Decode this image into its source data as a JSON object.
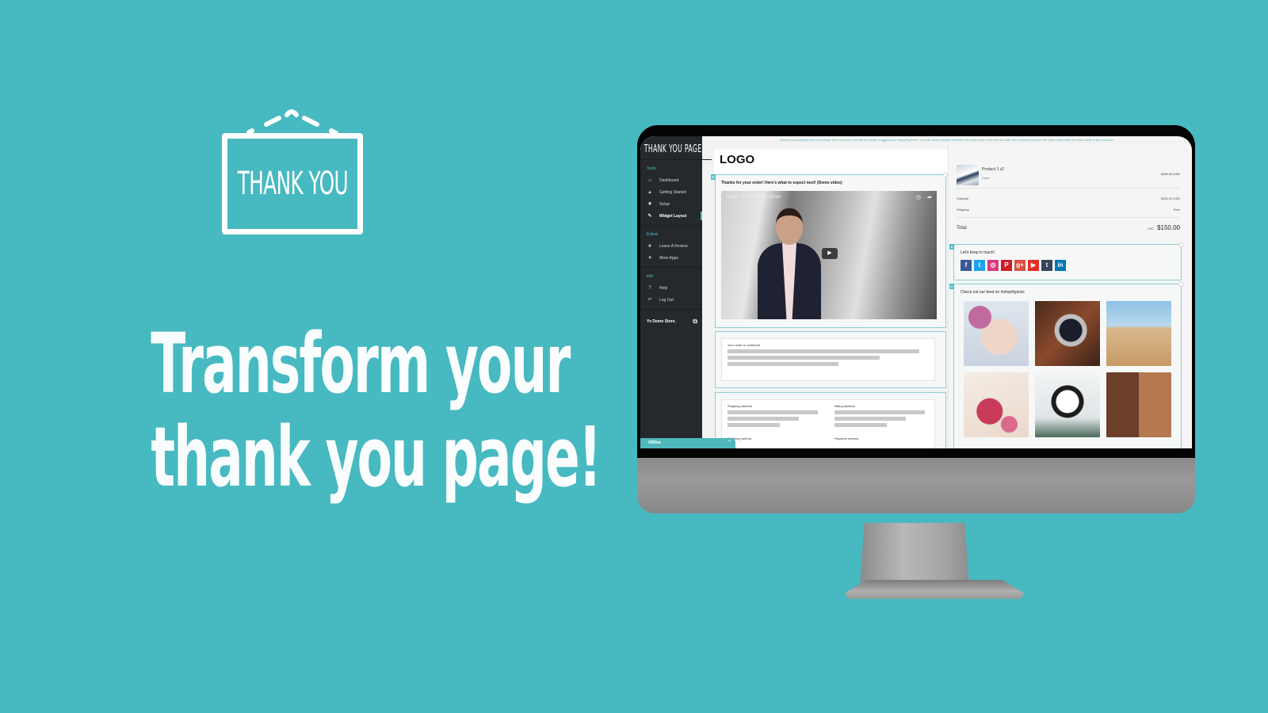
{
  "promo": {
    "sign_text": "THANK YOU",
    "headline_line1": "Transform your",
    "headline_line2": "thank you page!"
  },
  "colors": {
    "background": "#47b9c1",
    "accent": "#4fc0c7",
    "sidebar_bg": "#25292c"
  },
  "app": {
    "brand": "THANK YOU PAGE",
    "top_note": "Review your widgets and re-arrange them however you like by simply dragging and dropping them. You can move widgets between the main area in the left and also the summary area on the right underneath the total costs of the products.",
    "sidebar": {
      "sections": [
        {
          "label": "Tools",
          "items": [
            {
              "label": "Dashboard",
              "icon": "home-icon"
            },
            {
              "label": "Getting Started",
              "icon": "rocket-icon"
            },
            {
              "label": "Setup",
              "icon": "gear-icon"
            },
            {
              "label": "Widget Layout",
              "icon": "ruler-icon",
              "active": true
            }
          ]
        },
        {
          "label": "Extras",
          "items": [
            {
              "label": "Leave A Review",
              "icon": "star-icon"
            },
            {
              "label": "More Apps",
              "icon": "heart-icon"
            }
          ]
        },
        {
          "label": "Info",
          "items": [
            {
              "label": "Help",
              "icon": "question-icon"
            },
            {
              "label": "Log Out",
              "icon": "undo-icon"
            }
          ]
        }
      ],
      "store_name": "Yo Demo Store.",
      "status_label": "Offline"
    },
    "main": {
      "logo_text": "LOGO",
      "video_widget": {
        "tag": "B",
        "title": "Thanks for your order! Here's what to expect next! (Demo video)",
        "video_title": "Thank You For Your Order"
      },
      "confirmation": {
        "label": "Your order is confirmed"
      },
      "addresses": {
        "shipping_address": "Shipping address",
        "billing_address": "Billing address",
        "shipping_method": "Shipping method",
        "payment_method": "Payment method"
      }
    },
    "summary": {
      "product": {
        "name": "Product 1 x2",
        "variant": "Color",
        "price": "$150.00 USD"
      },
      "subtotal_label": "Subtotal",
      "subtotal_value": "$150.00 USD",
      "shipping_label": "Shipping",
      "shipping_value": "Free",
      "total_label": "Total",
      "total_currency": "USD",
      "total_value": "$150.00",
      "social_widget": {
        "tag": "A",
        "title": "Let's keep in touch!",
        "networks": [
          {
            "name": "facebook",
            "glyph": "f",
            "color": "#3b5998"
          },
          {
            "name": "twitter",
            "glyph": "t",
            "color": "#1da1f2"
          },
          {
            "name": "instagram",
            "glyph": "◎",
            "color": "#d93a7b"
          },
          {
            "name": "pinterest",
            "glyph": "P",
            "color": "#cb2027"
          },
          {
            "name": "google-plus",
            "glyph": "g+",
            "color": "#dc4e41"
          },
          {
            "name": "youtube",
            "glyph": "▶",
            "color": "#e52d27"
          },
          {
            "name": "tumblr",
            "glyph": "t",
            "color": "#35465c"
          },
          {
            "name": "linkedin",
            "glyph": "in",
            "color": "#0077b5"
          }
        ]
      },
      "feed_widget": {
        "tag": "C",
        "title": "Check out our feed on #shopifypicks",
        "items": [
          {
            "alt": "baby with pink bow - Christmas closing dates"
          },
          {
            "alt": "wristwatch"
          },
          {
            "alt": "bracelets on beach"
          },
          {
            "alt": "mug and floral tags"
          },
          {
            "alt": "candle tin"
          },
          {
            "alt": "kids collage"
          }
        ]
      }
    }
  }
}
